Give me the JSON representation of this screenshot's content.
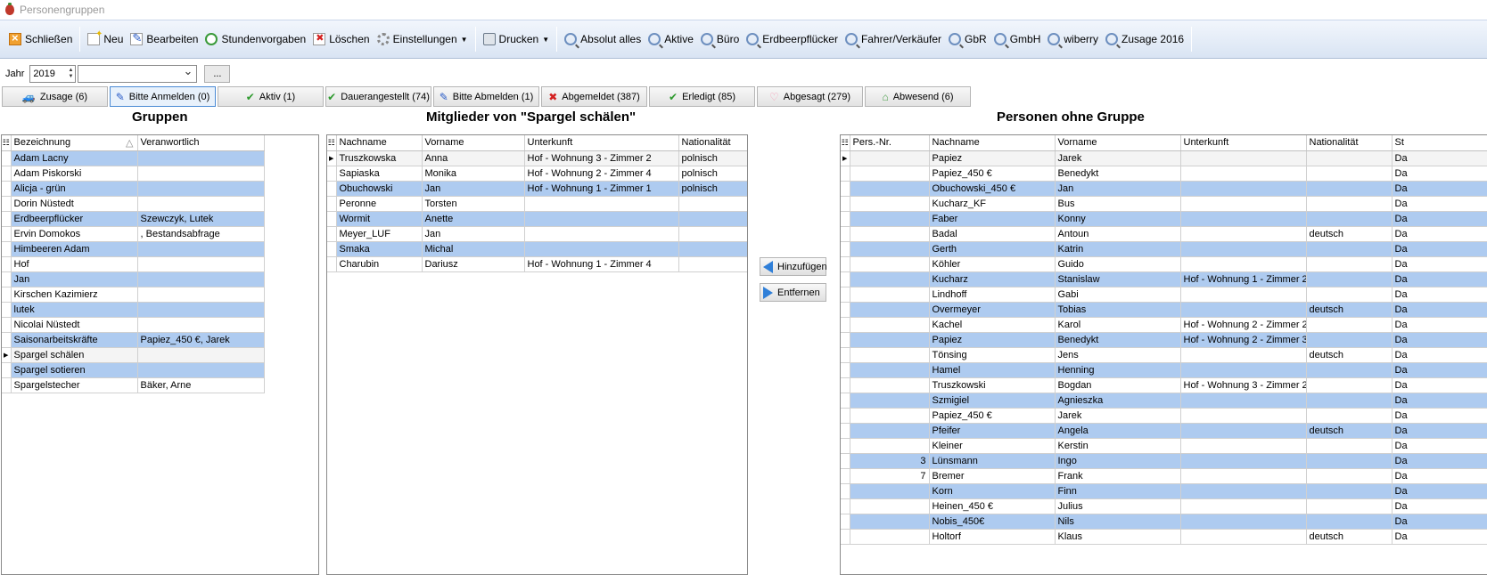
{
  "window": {
    "title": "Personengruppen"
  },
  "toolbar": {
    "close_label": "Schließen",
    "new_label": "Neu",
    "edit_label": "Bearbeiten",
    "hours_label": "Stundenvorgaben",
    "delete_label": "Löschen",
    "settings_label": "Einstellungen",
    "print_label": "Drucken",
    "filters": [
      "Absolut alles",
      "Aktive",
      "Büro",
      "Erdbeerpflücker",
      "Fahrer/Verkäufer",
      "GbR",
      "GmbH",
      "wiberry",
      "Zusage 2016"
    ]
  },
  "filter": {
    "year_label": "Jahr",
    "year_value": "2019",
    "combo_value": "",
    "dots_label": "..."
  },
  "status_tabs": [
    {
      "label": "Zusage (6)",
      "icon": "car-icon",
      "active": false
    },
    {
      "label": "Bitte Anmelden (0)",
      "icon": "pen-icon",
      "active": true
    },
    {
      "label": "Aktiv (1)",
      "icon": "check-icon",
      "active": false
    },
    {
      "label": "Dauerangestellt (74)",
      "icon": "check-icon",
      "active": false
    },
    {
      "label": "Bitte Abmelden (1)",
      "icon": "pen-icon",
      "active": false
    },
    {
      "label": "Abgemeldet (387)",
      "icon": "x-icon",
      "active": false
    },
    {
      "label": "Erledigt (85)",
      "icon": "check-icon",
      "active": false
    },
    {
      "label": "Abgesagt (279)",
      "icon": "heart-icon",
      "active": false
    },
    {
      "label": "Abwesend (6)",
      "icon": "house-icon",
      "active": false
    }
  ],
  "groups": {
    "title": "Gruppen",
    "columns": [
      "Bezeichnung",
      "Veranwortlich"
    ],
    "sort_indicator": "△",
    "current_row": 13,
    "rows": [
      [
        "Adam Lacny",
        ""
      ],
      [
        "Adam Piskorski",
        ""
      ],
      [
        "Alicja - grün",
        ""
      ],
      [
        "Dorin Nüstedt",
        ""
      ],
      [
        "Erdbeerpflücker",
        "Szewczyk, Lutek"
      ],
      [
        "Ervin Domokos",
        ", Bestandsabfrage"
      ],
      [
        "Himbeeren Adam",
        ""
      ],
      [
        "Hof",
        ""
      ],
      [
        "Jan",
        ""
      ],
      [
        "Kirschen Kazimierz",
        ""
      ],
      [
        "lutek",
        ""
      ],
      [
        "Nicolai Nüstedt",
        ""
      ],
      [
        "Saisonarbeitskräfte",
        "Papiez_450 €, Jarek"
      ],
      [
        "Spargel schälen",
        ""
      ],
      [
        "Spargel sotieren",
        ""
      ],
      [
        "Spargelstecher",
        "Bäker, Arne"
      ]
    ]
  },
  "members": {
    "title": "Mitglieder von \"Spargel schälen\"",
    "columns": [
      "Nachname",
      "Vorname",
      "Unterkunft",
      "Nationalität"
    ],
    "current_row": 0,
    "rows": [
      [
        "Truszkowska",
        "Anna",
        "Hof - Wohnung 3 - Zimmer 2",
        "polnisch"
      ],
      [
        "Sapiaska",
        "Monika",
        "Hof - Wohnung 2 - Zimmer 4",
        "polnisch"
      ],
      [
        "Obuchowski",
        "Jan",
        "Hof - Wohnung 1 - Zimmer 1",
        "polnisch"
      ],
      [
        "Peronne",
        "Torsten",
        "",
        ""
      ],
      [
        "Wormit",
        "Anette",
        "",
        ""
      ],
      [
        "Meyer_LUF",
        "Jan",
        "",
        ""
      ],
      [
        "Smaka",
        "Michal",
        "",
        ""
      ],
      [
        "Charubin",
        "Dariusz",
        "Hof - Wohnung 1 - Zimmer 4",
        ""
      ]
    ]
  },
  "actions": {
    "add_label": "Hinzufügen",
    "remove_label": "Entfernen"
  },
  "ungrouped": {
    "title": "Personen ohne Gruppe",
    "columns": [
      "Pers.-Nr.",
      "Nachname",
      "Vorname",
      "Unterkunft",
      "Nationalität",
      "St"
    ],
    "current_row": 0,
    "rows": [
      [
        "",
        "Papiez",
        "Jarek",
        "",
        "",
        "Da"
      ],
      [
        "",
        "Papiez_450 €",
        "Benedykt",
        "",
        "",
        "Da"
      ],
      [
        "",
        "Obuchowski_450 €",
        "Jan",
        "",
        "",
        "Da"
      ],
      [
        "",
        "Kucharz_KF",
        "Bus",
        "",
        "",
        "Da"
      ],
      [
        "",
        "Faber",
        "Konny",
        "",
        "",
        "Da"
      ],
      [
        "",
        "Badal",
        "Antoun",
        "",
        "deutsch",
        "Da"
      ],
      [
        "",
        "Gerth",
        "Katrin",
        "",
        "",
        "Da"
      ],
      [
        "",
        "Köhler",
        "Guido",
        "",
        "",
        "Da"
      ],
      [
        "",
        "Kucharz",
        "Stanislaw",
        "Hof - Wohnung 1 - Zimmer 2",
        "",
        "Da"
      ],
      [
        "",
        "Lindhoff",
        "Gabi",
        "",
        "",
        "Da"
      ],
      [
        "",
        "Overmeyer",
        "Tobias",
        "",
        "deutsch",
        "Da"
      ],
      [
        "",
        "Kachel",
        "Karol",
        "Hof - Wohnung 2 - Zimmer 2",
        "",
        "Da"
      ],
      [
        "",
        "Papiez",
        "Benedykt",
        "Hof - Wohnung 2 - Zimmer 3",
        "",
        "Da"
      ],
      [
        "",
        "Tönsing",
        "Jens",
        "",
        "deutsch",
        "Da"
      ],
      [
        "",
        "Hamel",
        "Henning",
        "",
        "",
        "Da"
      ],
      [
        "",
        "Truszkowski",
        "Bogdan",
        "Hof - Wohnung 3 - Zimmer 2",
        "",
        "Da"
      ],
      [
        "",
        "Szmigiel",
        "Agnieszka",
        "",
        "",
        "Da"
      ],
      [
        "",
        "Papiez_450 €",
        "Jarek",
        "",
        "",
        "Da"
      ],
      [
        "",
        "Pfeifer",
        "Angela",
        "",
        "deutsch",
        "Da"
      ],
      [
        "",
        "Kleiner",
        "Kerstin",
        "",
        "",
        "Da"
      ],
      [
        "3",
        "Lünsmann",
        "Ingo",
        "",
        "",
        "Da"
      ],
      [
        "7",
        "Bremer",
        "Frank",
        "",
        "",
        "Da"
      ],
      [
        "",
        "Korn",
        "Finn",
        "",
        "",
        "Da"
      ],
      [
        "",
        "Heinen_450 €",
        "Julius",
        "",
        "",
        "Da"
      ],
      [
        "",
        "Nobis_450€",
        "Nils",
        "",
        "",
        "Da"
      ],
      [
        "",
        "Holtorf",
        "Klaus",
        "",
        "deutsch",
        "Da"
      ]
    ]
  }
}
